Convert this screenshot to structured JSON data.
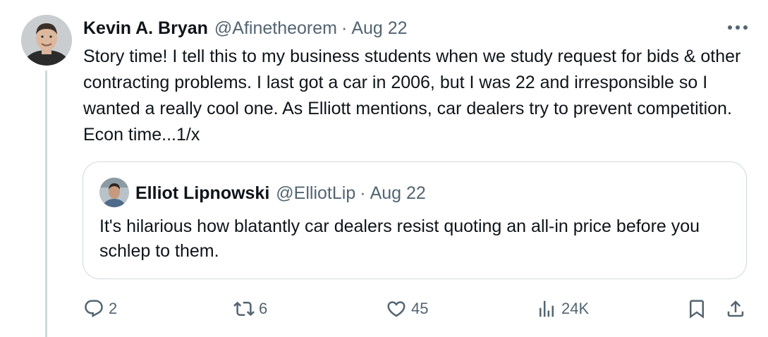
{
  "tweet": {
    "author_name": "Kevin A. Bryan",
    "handle": "@Afinetheorem",
    "separator": "·",
    "date": "Aug 22",
    "text": "Story time! I tell this to my business students when we study request for bids & other contracting problems. I last got a car in 2006, but I was 22 and irresponsible so I wanted a really cool one. As Elliott mentions, car dealers try to prevent competition. Econ time...1/x"
  },
  "quoted_tweet": {
    "author_name": "Elliot Lipnowski",
    "handle": "@ElliotLip",
    "separator": "·",
    "date": "Aug 22",
    "text": "It's hilarious how blatantly car dealers resist quoting an all-in price before you schlep to them."
  },
  "actions": {
    "replies": "2",
    "reposts": "6",
    "likes": "45",
    "views": "24K"
  },
  "icons": {
    "reply": "reply-icon",
    "repost": "repost-icon",
    "like": "heart-icon",
    "views": "views-icon",
    "bookmark": "bookmark-icon",
    "share": "share-icon",
    "more": "more-icon"
  },
  "colors": {
    "text": "#0f1419",
    "secondary": "#536471",
    "border": "#cfd9de"
  }
}
